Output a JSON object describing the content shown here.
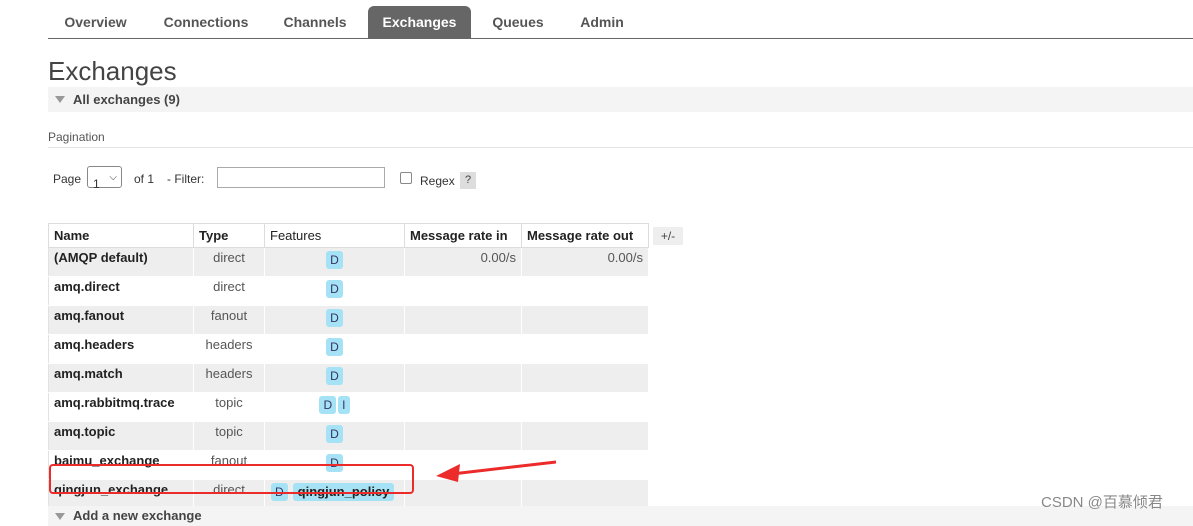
{
  "nav": {
    "tabs": [
      {
        "label": "Overview",
        "active": false
      },
      {
        "label": "Connections",
        "active": false
      },
      {
        "label": "Channels",
        "active": false
      },
      {
        "label": "Exchanges",
        "active": true
      },
      {
        "label": "Queues",
        "active": false
      },
      {
        "label": "Admin",
        "active": false
      }
    ]
  },
  "page": {
    "title": "Exchanges",
    "section_title": "All exchanges (9)",
    "pagination_label": "Pagination"
  },
  "pagination": {
    "page_label": "Page",
    "page_value": "1",
    "of_label": "of 1",
    "filter_label": "- Filter:",
    "filter_value": "",
    "regex_label": "Regex",
    "regex_checked": false,
    "help_label": "?"
  },
  "table": {
    "headers": {
      "name": "Name",
      "type": "Type",
      "features": "Features",
      "rate_in": "Message rate in",
      "rate_out": "Message rate out"
    },
    "columns_toggle": "+/-",
    "rows": [
      {
        "name": "(AMQP default)",
        "type": "direct",
        "features": [
          "D"
        ],
        "policy": "",
        "rate_in": "0.00/s",
        "rate_out": "0.00/s"
      },
      {
        "name": "amq.direct",
        "type": "direct",
        "features": [
          "D"
        ],
        "policy": "",
        "rate_in": "",
        "rate_out": ""
      },
      {
        "name": "amq.fanout",
        "type": "fanout",
        "features": [
          "D"
        ],
        "policy": "",
        "rate_in": "",
        "rate_out": ""
      },
      {
        "name": "amq.headers",
        "type": "headers",
        "features": [
          "D"
        ],
        "policy": "",
        "rate_in": "",
        "rate_out": ""
      },
      {
        "name": "amq.match",
        "type": "headers",
        "features": [
          "D"
        ],
        "policy": "",
        "rate_in": "",
        "rate_out": ""
      },
      {
        "name": "amq.rabbitmq.trace",
        "type": "topic",
        "features": [
          "D",
          "I"
        ],
        "policy": "",
        "rate_in": "",
        "rate_out": ""
      },
      {
        "name": "amq.topic",
        "type": "topic",
        "features": [
          "D"
        ],
        "policy": "",
        "rate_in": "",
        "rate_out": ""
      },
      {
        "name": "baimu_exchange",
        "type": "fanout",
        "features": [
          "D"
        ],
        "policy": "",
        "rate_in": "",
        "rate_out": ""
      },
      {
        "name": "qingjun_exchange",
        "type": "direct",
        "features": [
          "D"
        ],
        "policy": "qingjun_policy",
        "rate_in": "",
        "rate_out": ""
      }
    ]
  },
  "add_section": {
    "title": "Add a new exchange"
  },
  "watermark": "CSDN @百慕倾君",
  "colors": {
    "active_tab": "#666666",
    "badge": "#a6e2f5",
    "highlight": "#ec2b2b"
  }
}
